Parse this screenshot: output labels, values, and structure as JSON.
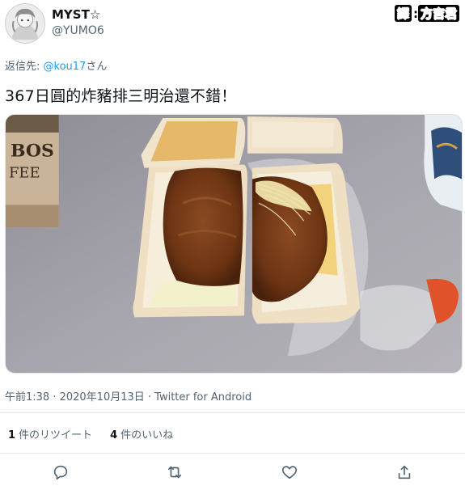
{
  "user": {
    "display_name": "MYST☆",
    "handle": "@YUMO6"
  },
  "watermark": {
    "part1": "譯",
    "part2": "方吉君"
  },
  "reply": {
    "prefix": "返信先: ",
    "mention": "@kou17",
    "suffix": "さん"
  },
  "tweet": {
    "text": "367日圓的炸豬排三明治還不錯！"
  },
  "meta": {
    "timestamp": "午前1:38 · 2020年10月13日 · Twitter for Android"
  },
  "stats": {
    "retweet_count": "1",
    "retweet_label": "件のリツイート",
    "like_count": "4",
    "like_label": "件のいいね"
  },
  "actions": {
    "reply": "reply-icon",
    "retweet": "retweet-icon",
    "like": "heart-icon",
    "share": "share-icon"
  }
}
